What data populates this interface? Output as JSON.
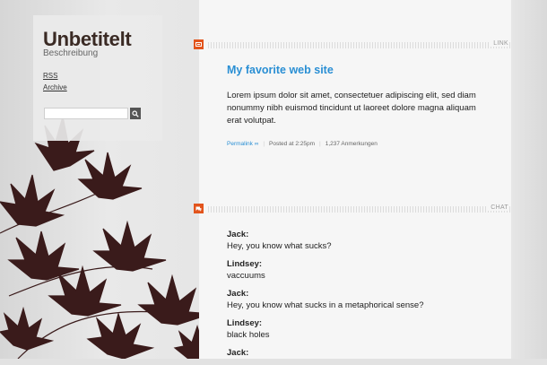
{
  "blog": {
    "title": "Unbetitelt",
    "description": "Beschreibung",
    "nav": {
      "rss": "RSS",
      "archive": "Archive"
    },
    "search": {
      "placeholder": "",
      "value": ""
    }
  },
  "colors": {
    "accent": "#2a8fd4",
    "post_type_icon": "#e2541c",
    "leaves": "#3a1b1b"
  },
  "icons": {
    "search": "magnifier-icon",
    "link": "link-icon",
    "chat": "chat-bubble-icon"
  },
  "posts": [
    {
      "type_label": "LINK",
      "title": "My favorite web site",
      "body": "Lorem ipsum dolor sit amet, consectetuer adipiscing elit, sed diam nonummy nibh euismod tincidunt ut laoreet dolore magna aliquam erat volutpat.",
      "meta": {
        "permalink": "Permalink ∞",
        "posted": "Posted at 2:25pm",
        "notes": "1,237 Anmerkungen"
      }
    },
    {
      "type_label": "CHAT",
      "lines": [
        {
          "speaker": "Jack:",
          "text": "Hey, you know what sucks?"
        },
        {
          "speaker": "Lindsey:",
          "text": "vaccuums"
        },
        {
          "speaker": "Jack:",
          "text": "Hey, you know what sucks in a metaphorical sense?"
        },
        {
          "speaker": "Lindsey:",
          "text": "black holes"
        },
        {
          "speaker": "Jack:",
          "text": ""
        }
      ]
    }
  ]
}
